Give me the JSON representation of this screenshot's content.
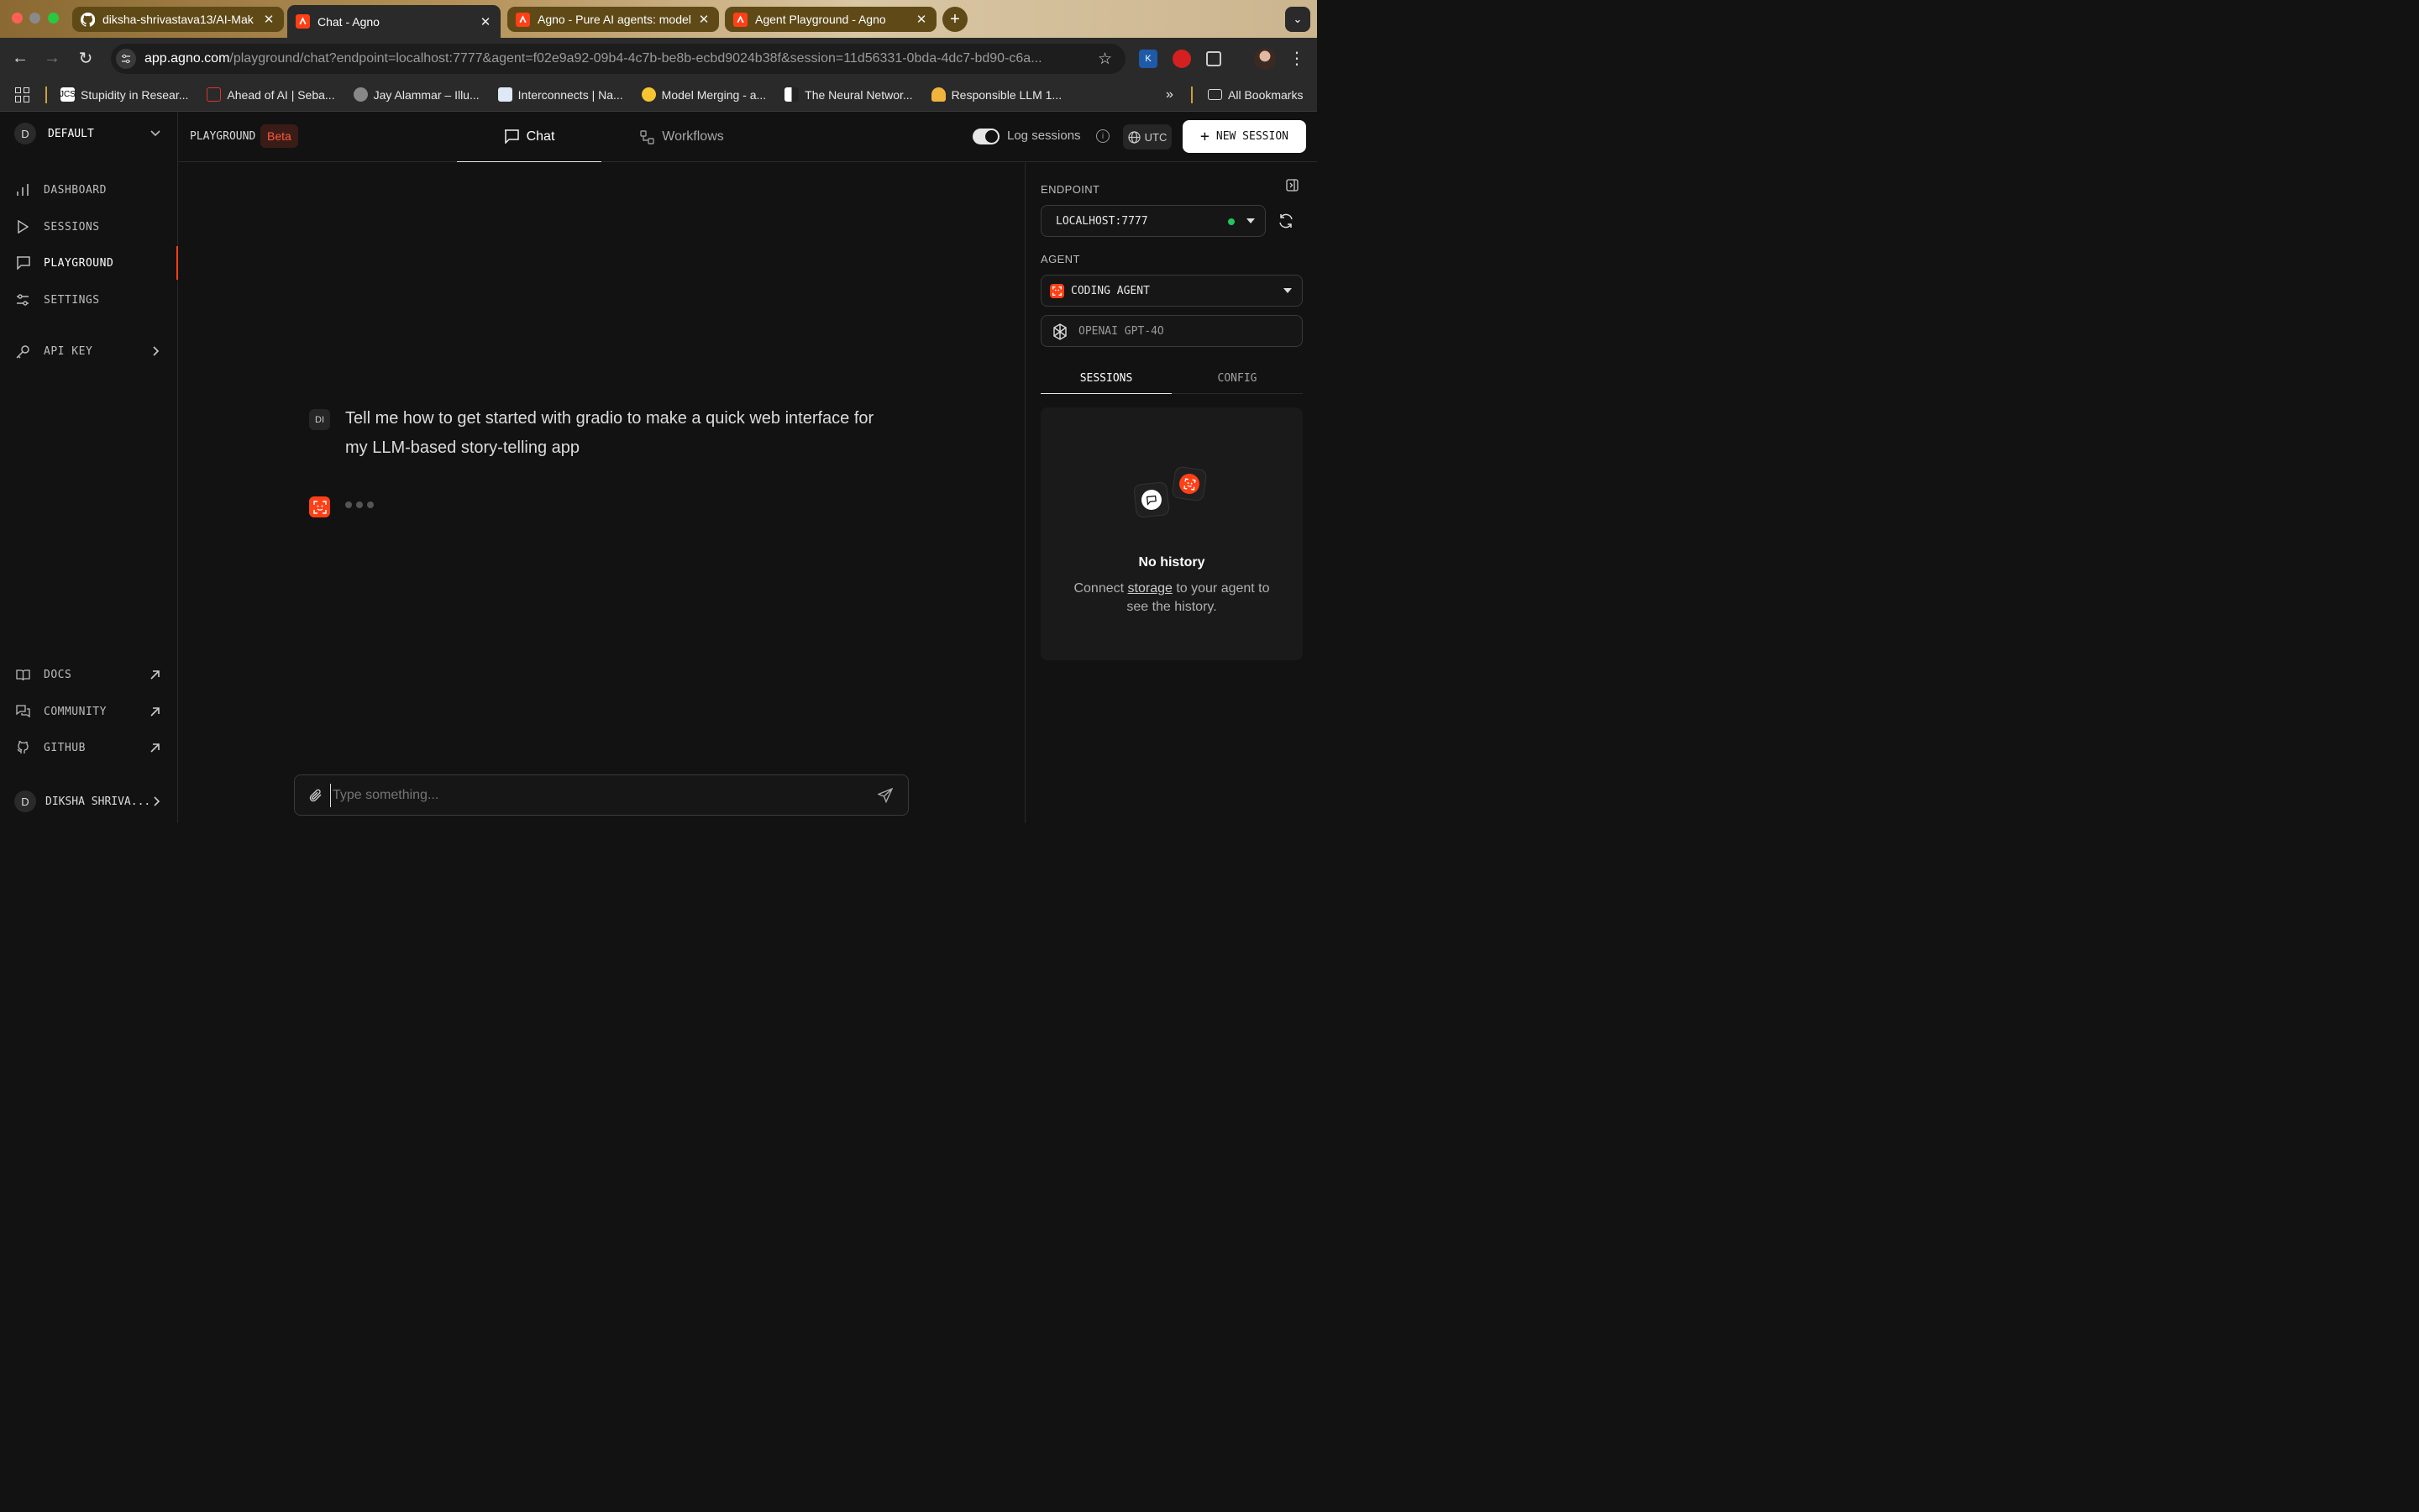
{
  "browser": {
    "tabs": [
      {
        "title": "diksha-shrivastava13/AI-Mak",
        "favicon": "github-icon"
      },
      {
        "title": "Chat - Agno",
        "favicon": "agno-icon"
      },
      {
        "title": "Agno - Pure AI agents: model",
        "favicon": "agno-icon"
      },
      {
        "title": "Agent Playground - Agno",
        "favicon": "agno-icon"
      }
    ],
    "url_host": "app.agno.com",
    "url_path": "/playground/chat?endpoint=localhost:7777&agent=f02e9a92-09b4-4c7b-be8b-ecbd9024b38f&session=11d56331-0bda-4dc7-bd90-c6a...",
    "bookmarks": [
      "Stupidity in Resear...",
      "Ahead of AI | Seba...",
      "Jay Alammar – Illu...",
      "Interconnects | Na...",
      "Model Merging - a...",
      "The Neural Networ...",
      "Responsible LLM 1..."
    ],
    "bookmarks_overflow": "»",
    "all_bookmarks": "All Bookmarks"
  },
  "sidebar": {
    "workspace_initial": "D",
    "workspace": "DEFAULT",
    "nav": [
      {
        "label": "DASHBOARD",
        "icon": "bar-chart-icon"
      },
      {
        "label": "SESSIONS",
        "icon": "play-icon"
      },
      {
        "label": "PLAYGROUND",
        "icon": "message-square-icon"
      },
      {
        "label": "SETTINGS",
        "icon": "sliders-icon"
      },
      {
        "label": "API KEY",
        "icon": "key-icon"
      }
    ],
    "footer_links": [
      {
        "label": "DOCS",
        "icon": "book-icon"
      },
      {
        "label": "COMMUNITY",
        "icon": "chat-bubbles-icon"
      },
      {
        "label": "GITHUB",
        "icon": "github-icon"
      }
    ],
    "user_initial": "D",
    "user_name": "DIKSHA SHRIVA..."
  },
  "topbar": {
    "section": "PLAYGROUND",
    "beta": "Beta",
    "tabs": [
      {
        "label": "Chat",
        "active": true
      },
      {
        "label": "Workflows",
        "active": false
      }
    ],
    "log_sessions": "Log sessions",
    "log_sessions_enabled": true,
    "timezone": "UTC",
    "new_session": "NEW SESSION"
  },
  "chat": {
    "user_initials": "DI",
    "user_message": "Tell me how to get started with gradio to make a quick web interface for my LLM-based story-telling app",
    "agent_state": "typing",
    "input_placeholder": "Type something..."
  },
  "right_panel": {
    "endpoint_label": "ENDPOINT",
    "endpoint_value": "LOCALHOST:7777",
    "endpoint_status_color": "#22c55e",
    "agent_label": "AGENT",
    "agent_value": "CODING AGENT",
    "model_value": "OPENAI GPT-4O",
    "tabs": [
      {
        "label": "SESSIONS",
        "active": true
      },
      {
        "label": "CONFIG",
        "active": false
      }
    ],
    "empty_title": "No history",
    "empty_text_before": "Connect ",
    "empty_link": "storage",
    "empty_text_after": " to your agent to see the history."
  },
  "colors": {
    "accent": "#ff4017",
    "background": "#121212",
    "tab_group": "#5f4a17"
  }
}
